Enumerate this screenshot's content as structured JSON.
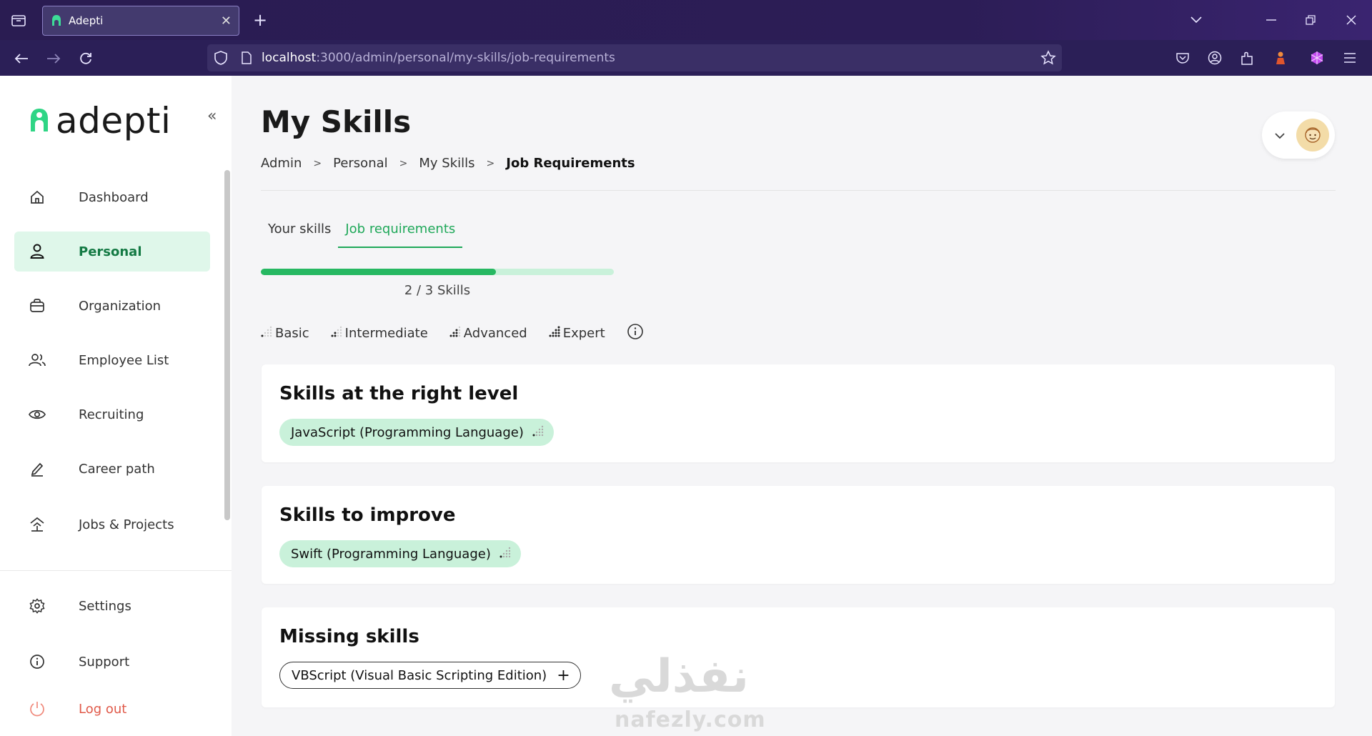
{
  "browser": {
    "tab_title": "Adepti",
    "tab_close": "✕",
    "new_tab": "+",
    "url_host": "localhost",
    "url_path": ":3000/admin/personal/my-skills/job-requirements"
  },
  "sidebar": {
    "logo_text": "adepti",
    "collapse_glyph": "«",
    "items": [
      {
        "label": "Dashboard",
        "icon": "home-icon"
      },
      {
        "label": "Personal",
        "icon": "user-icon",
        "active": true
      },
      {
        "label": "Organization",
        "icon": "briefcase-icon"
      },
      {
        "label": "Employee List",
        "icon": "users-icon"
      },
      {
        "label": "Recruiting",
        "icon": "eye-icon"
      },
      {
        "label": "Career path",
        "icon": "pen-icon"
      },
      {
        "label": "Jobs & Projects",
        "icon": "jobs-icon"
      }
    ],
    "bottom_items": [
      {
        "label": "Settings",
        "icon": "gear-icon"
      },
      {
        "label": "Support",
        "icon": "info-icon"
      },
      {
        "label": "Log out",
        "icon": "power-icon"
      }
    ]
  },
  "header": {
    "title": "My Skills",
    "breadcrumb": [
      "Admin",
      "Personal",
      "My Skills",
      "Job Requirements"
    ],
    "breadcrumb_sep": ">"
  },
  "tabs": [
    {
      "label": "Your skills",
      "active": false
    },
    {
      "label": "Job requirements",
      "active": true
    }
  ],
  "progress": {
    "value": 2,
    "total": 3,
    "label": "2 / 3 Skills",
    "fraction": 0.667
  },
  "legend": [
    "Basic",
    "Intermediate",
    "Advanced",
    "Expert"
  ],
  "sections": [
    {
      "title": "Skills at the right level",
      "chips": [
        {
          "label": "JavaScript (Programming Language)",
          "level": "Basic"
        }
      ]
    },
    {
      "title": "Skills to improve",
      "chips": [
        {
          "label": "Swift (Programming Language)",
          "level": "Basic"
        }
      ]
    },
    {
      "title": "Missing skills",
      "chips": [
        {
          "label": "VBScript (Visual Basic Scripting Edition)",
          "add": "+"
        }
      ]
    }
  ],
  "watermark": {
    "arabic": "نفذلي",
    "latin": "nafezly.com"
  },
  "colors": {
    "accent": "#1fa859",
    "accent_light": "#c9f1da",
    "browser_bg": "#2b1f57",
    "logout": "#e05a4a"
  }
}
